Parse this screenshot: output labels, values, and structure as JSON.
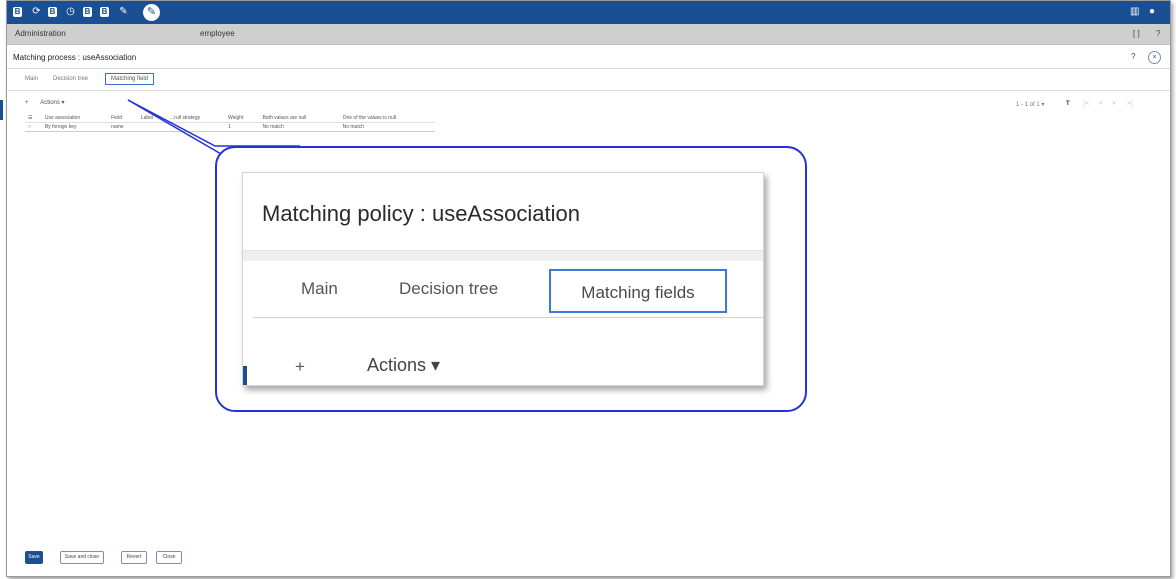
{
  "topbar": {
    "icons": [
      "db-icon",
      "refresh-icon",
      "doc-icon",
      "clock-icon",
      "copy-icon",
      "export-icon",
      "pin-icon",
      "wrench-icon"
    ],
    "right_icons": [
      "grid-icon",
      "user-icon"
    ],
    "bg": "#1a4f93"
  },
  "adminbar": {
    "section": "Administration",
    "entity": "employee",
    "expand": "[ ]",
    "help": "?"
  },
  "panel": {
    "title": "Matching process : useAssociation",
    "help": "?",
    "close": "×"
  },
  "tabs": [
    {
      "label": "Main"
    },
    {
      "label": "Decision tree"
    },
    {
      "label": "Matching field",
      "active": true
    }
  ],
  "toolbar": {
    "add": "+",
    "actions": "Actions ▾"
  },
  "pager": {
    "range": "1 - 1 of 1 ▾",
    "filter": "T",
    "first": "|<",
    "prev": "<",
    "next": ">",
    "last": ">|"
  },
  "grid": {
    "columns": [
      "Use association",
      "Field",
      "Label",
      "...rull strategy",
      "Weight",
      "Both values are null",
      "One of the values is null"
    ],
    "rows": [
      [
        "By foreign key",
        "name",
        "",
        "",
        "1",
        "No match",
        "No match"
      ]
    ]
  },
  "footer": {
    "save": "Save",
    "save_close": "Save and close",
    "revert": "Revert",
    "close": "Close"
  },
  "callout": {
    "title": "Matching  policy  : useAssociation",
    "tabs": [
      "Main",
      "Decision tree",
      "Matching fields"
    ],
    "plus": "+",
    "actions": "Actions ▾",
    "border_color": "#2433d8"
  }
}
